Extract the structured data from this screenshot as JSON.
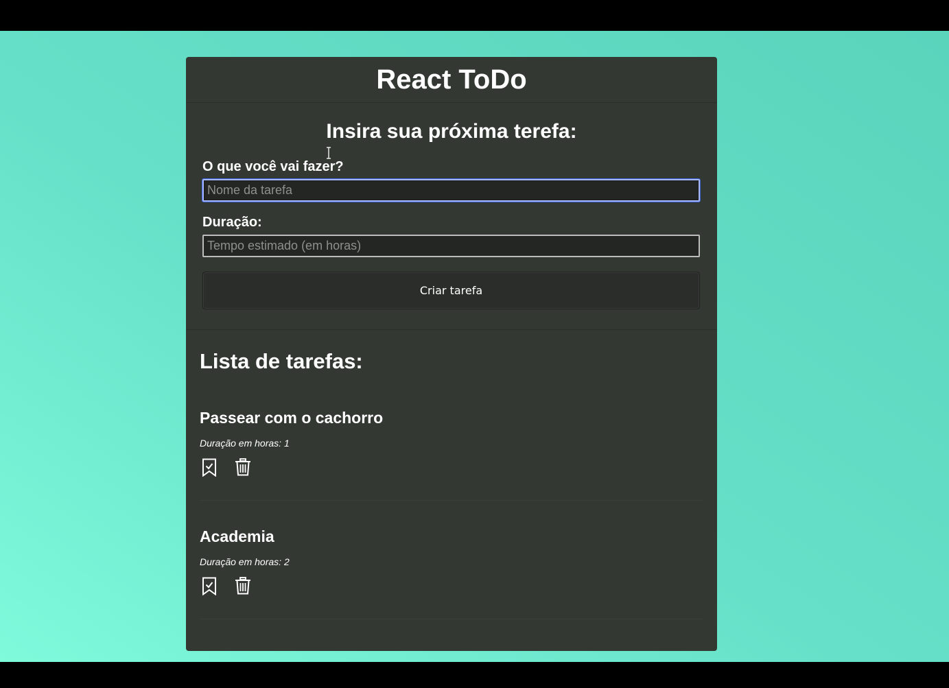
{
  "app": {
    "title": "React ToDo"
  },
  "form": {
    "title": "Insira sua próxima terefa:",
    "task_label": "O que você vai fazer?",
    "task_placeholder": "Nome da tarefa",
    "task_value": "",
    "duration_label": "Duração:",
    "duration_placeholder": "Tempo estimado (em horas)",
    "duration_value": "",
    "submit_label": "Criar tarefa"
  },
  "list": {
    "title": "Lista de tarefas:",
    "tasks": [
      {
        "name": "Passear com o cachorro",
        "duration_text": "Duração em horas: 1",
        "complete_icon": "bookmark-check-icon",
        "delete_icon": "trash-icon"
      },
      {
        "name": "Academia",
        "duration_text": "Duração em horas: 2",
        "complete_icon": "bookmark-check-icon",
        "delete_icon": "trash-icon"
      }
    ]
  },
  "colors": {
    "card_background": "#333833",
    "page_gradient_top": "#5ad4bb",
    "page_gradient_bottom": "#7ffadb",
    "focus_ring": "#a7b7ff"
  }
}
